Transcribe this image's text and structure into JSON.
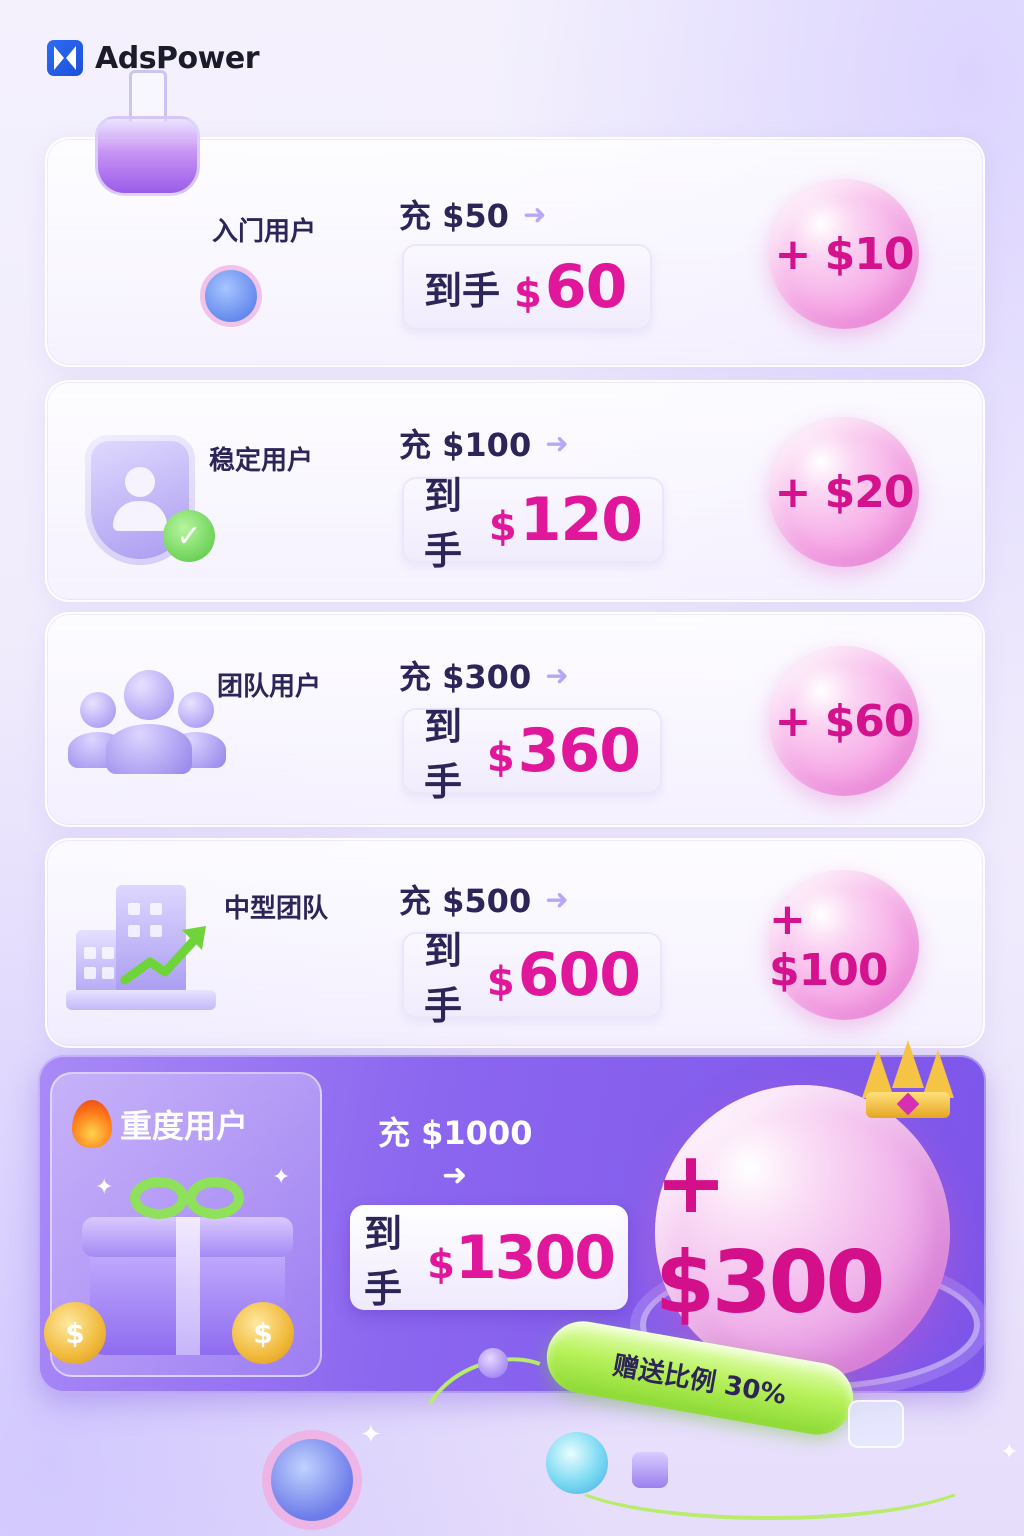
{
  "brand": {
    "name": "AdsPower",
    "accent": "#2c6cf6"
  },
  "colors": {
    "highlight": "#e0179a",
    "text": "#2d2457",
    "heavy_bg": "#8b66ef",
    "tube": "#b8f25c"
  },
  "tiers": [
    {
      "label": "入门用户",
      "recharge": "充 $50",
      "receive_label": "到手",
      "receive_currency": "$",
      "receive_amount": "60",
      "bonus": "+ $10",
      "icon": "flask-icon"
    },
    {
      "label": "稳定用户",
      "recharge": "充 $100",
      "receive_label": "到手",
      "receive_currency": "$",
      "receive_amount": "120",
      "bonus": "+ $20",
      "icon": "shield-user-icon"
    },
    {
      "label": "团队用户",
      "recharge": "充 $300",
      "receive_label": "到手",
      "receive_currency": "$",
      "receive_amount": "360",
      "bonus": "+ $60",
      "icon": "team-icon"
    },
    {
      "label": "中型团队",
      "recharge": "充 $500",
      "receive_label": "到手",
      "receive_currency": "$",
      "receive_amount": "600",
      "bonus": "+ $100",
      "icon": "building-growth-icon"
    }
  ],
  "heavy": {
    "label": "重度用户",
    "recharge": "充 $1000",
    "receive_label": "到手",
    "receive_currency": "$",
    "receive_amount": "1300",
    "bonus": "+ $300",
    "ratio_text": "赠送比例 30%",
    "icon": "gift-icon",
    "coin_symbol": "$"
  },
  "arrow_glyph": "➜"
}
